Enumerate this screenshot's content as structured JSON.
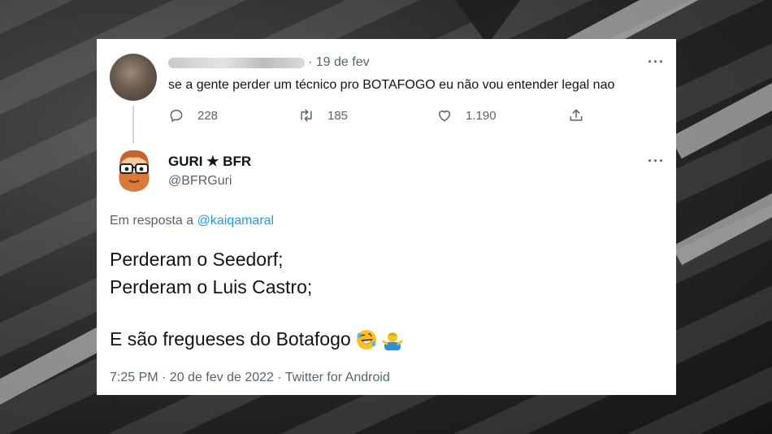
{
  "colors": {
    "accent": "#1d9bf0",
    "text": "#0f1419",
    "muted": "#536471"
  },
  "tweet1": {
    "date": "· 19 de fev",
    "text": "se a gente perder um técnico pro BOTAFOGO eu não vou entender legal nao",
    "more": "···",
    "replies": "228",
    "retweets": "185",
    "likes": "1.190",
    "icons": {
      "reply": "reply-icon",
      "retweet": "retweet-icon",
      "like": "heart-icon",
      "share": "share-icon"
    }
  },
  "tweet2": {
    "display_name": "GURI ★ BFR",
    "handle": "@BFRGuri",
    "more": "···",
    "reply_prefix": "Em resposta a ",
    "reply_mention": "@kaiqamaral",
    "line1": "Perderam o Seedorf;",
    "line2": "Perderam o Luis Castro;",
    "line3": "E são fregueses do Botafogo",
    "emojis": [
      "rolling-laughing-emoji",
      "man-shrugging-emoji"
    ],
    "meta": "7:25 PM · 20 de fev de 2022 · Twitter for Android"
  }
}
